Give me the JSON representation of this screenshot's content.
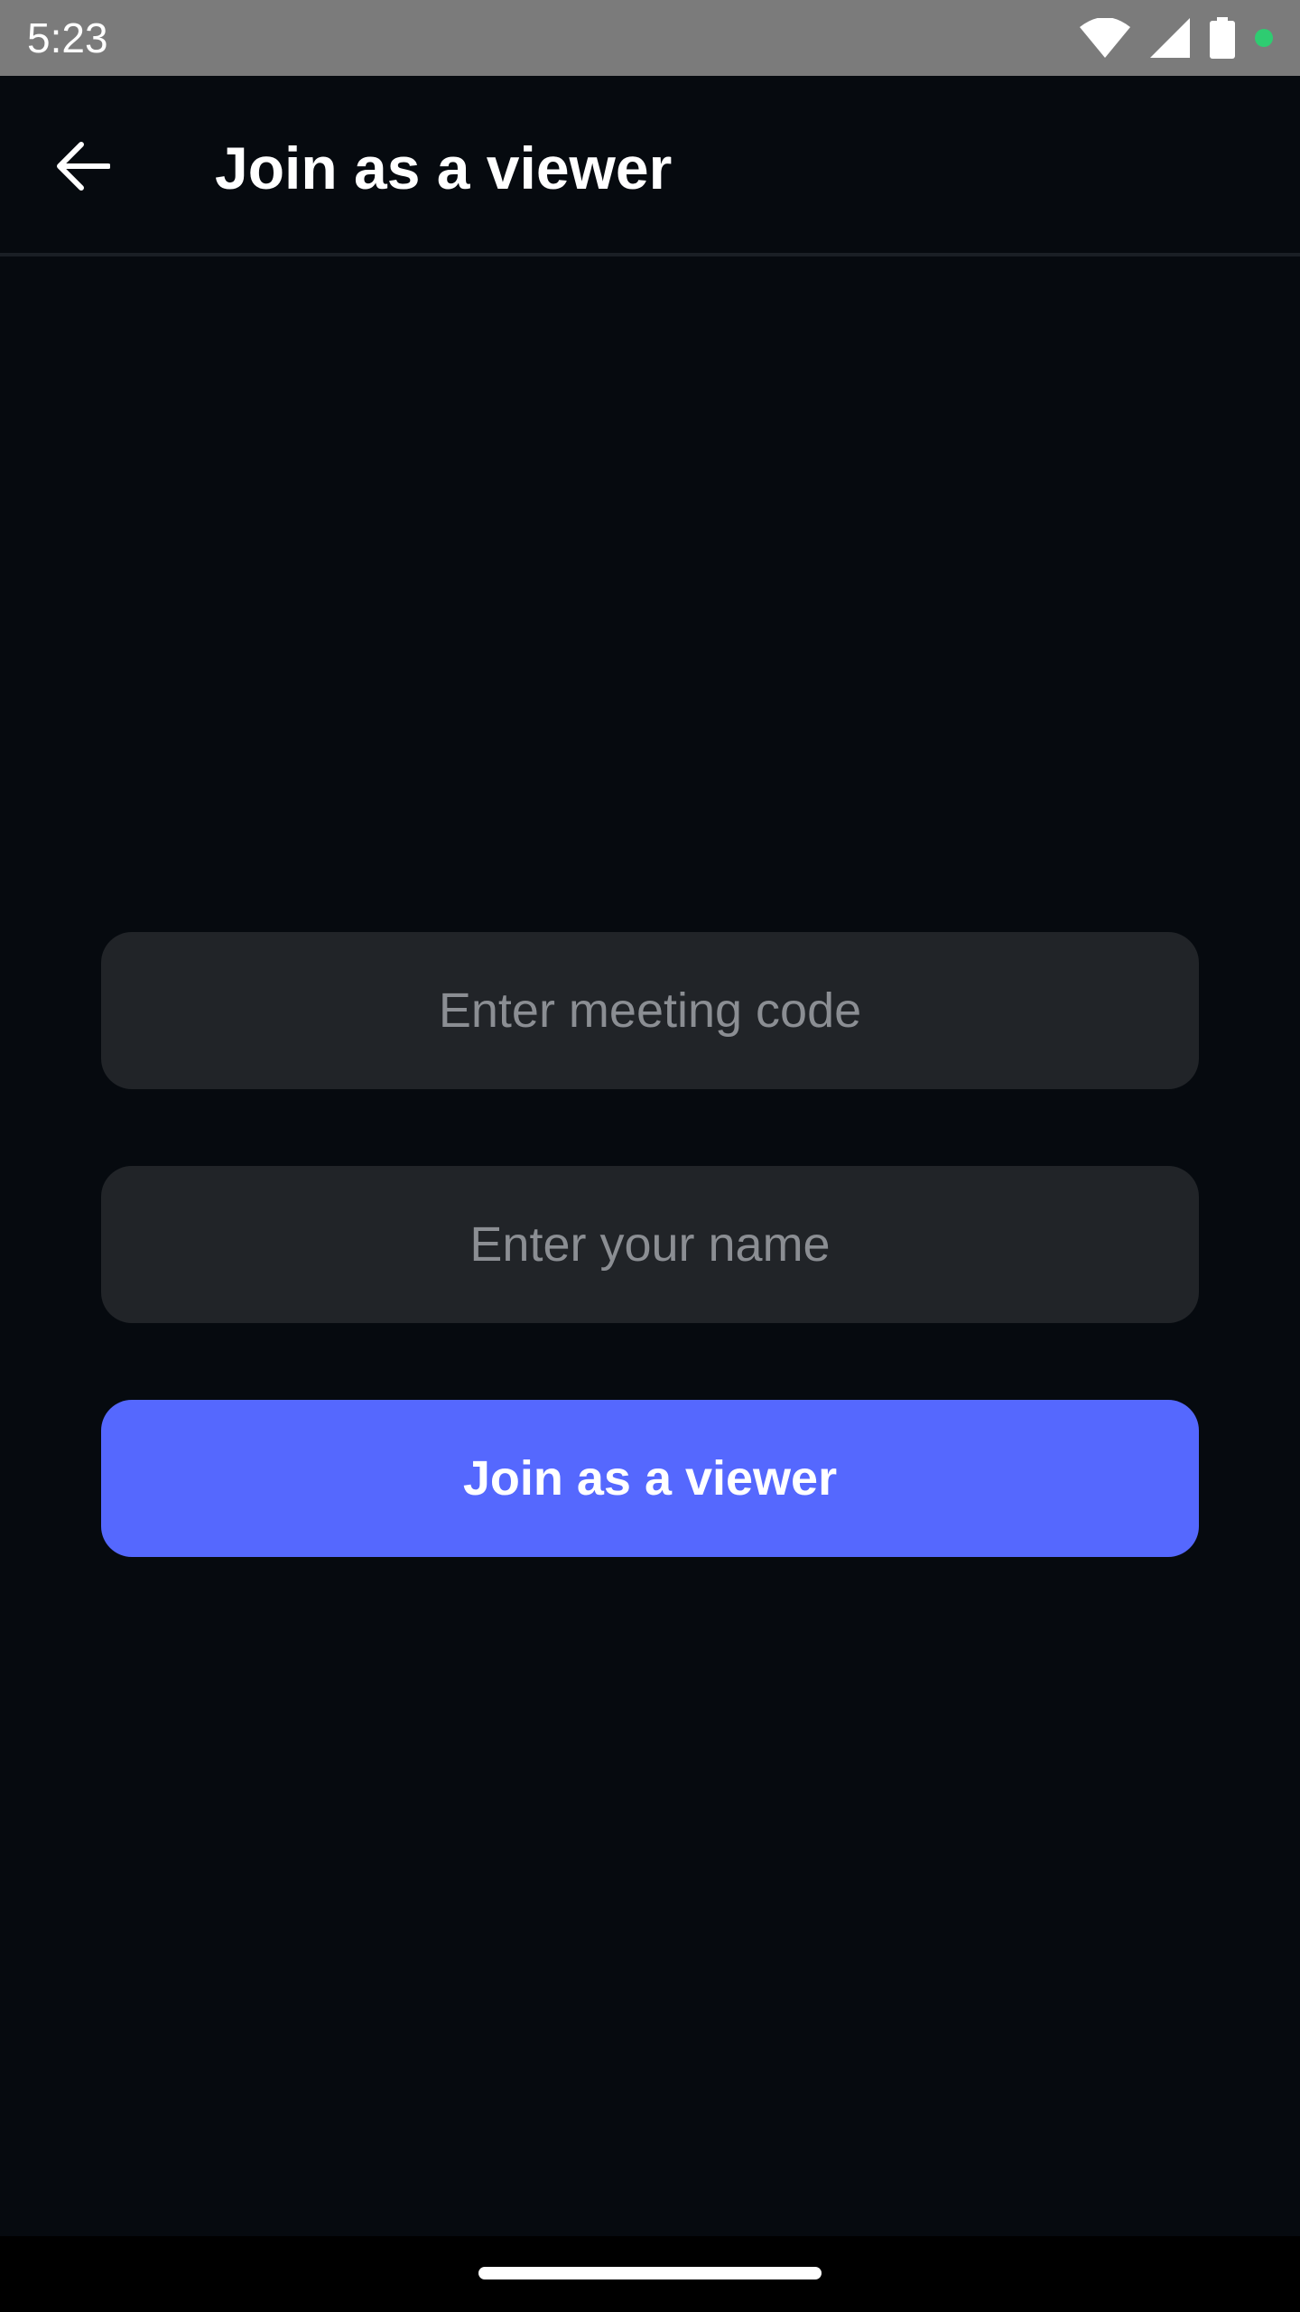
{
  "status_bar": {
    "time": "5:23",
    "icons": [
      "wifi-icon",
      "cellular-signal-icon",
      "battery-icon",
      "notification-dot-icon"
    ],
    "notification_dot_color": "#2ecc71"
  },
  "app_bar": {
    "back_icon": "arrow-back-icon",
    "title": "Join as a viewer"
  },
  "form": {
    "meeting_code": {
      "value": "",
      "placeholder": "Enter meeting code"
    },
    "name": {
      "value": "",
      "placeholder": "Enter your name"
    },
    "join_button_label": "Join as a viewer"
  },
  "colors": {
    "background": "#060a0f",
    "input_background": "#212428",
    "accent": "#5568fe",
    "status_bar": "#7b7b7b"
  }
}
